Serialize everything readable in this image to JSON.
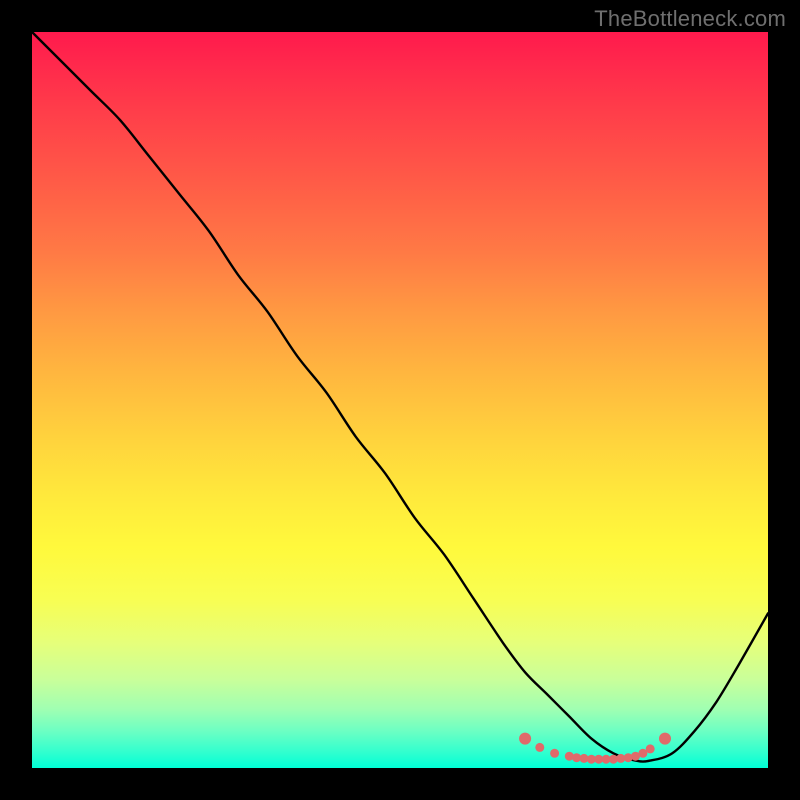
{
  "watermark": "TheBottleneck.com",
  "chart_data": {
    "type": "line",
    "title": "",
    "xlabel": "",
    "ylabel": "",
    "xlim": [
      0,
      100
    ],
    "ylim": [
      0,
      100
    ],
    "grid": false,
    "series": [
      {
        "name": "curve",
        "x": [
          0,
          4,
          8,
          12,
          16,
          20,
          24,
          28,
          32,
          36,
          40,
          44,
          48,
          52,
          56,
          60,
          64,
          67,
          70,
          73,
          76,
          79,
          82,
          84,
          87,
          90,
          93,
          96,
          100
        ],
        "values": [
          100,
          96,
          92,
          88,
          83,
          78,
          73,
          67,
          62,
          56,
          51,
          45,
          40,
          34,
          29,
          23,
          17,
          13,
          10,
          7,
          4,
          2,
          1,
          1,
          2,
          5,
          9,
          14,
          21
        ]
      },
      {
        "name": "highlight-dots",
        "x": [
          67,
          69,
          71,
          73,
          74,
          75,
          76,
          77,
          78,
          79,
          80,
          81,
          82,
          83,
          84,
          86
        ],
        "values": [
          4,
          2.8,
          2.0,
          1.6,
          1.4,
          1.3,
          1.2,
          1.2,
          1.2,
          1.2,
          1.3,
          1.4,
          1.6,
          2.0,
          2.6,
          4.0
        ]
      }
    ]
  }
}
